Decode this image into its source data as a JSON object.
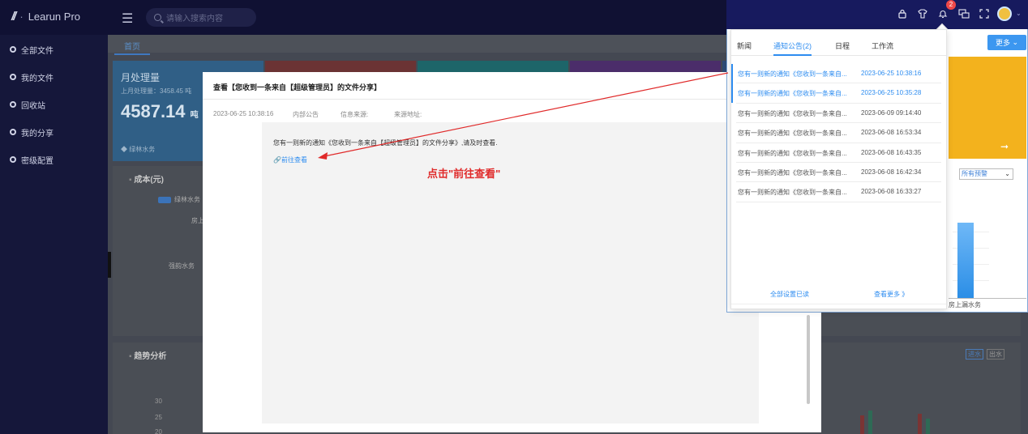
{
  "app": {
    "logo_text": "Learun Pro",
    "search_placeholder": "请输入搜索内容"
  },
  "sidebar": {
    "items": [
      {
        "label": "全部文件",
        "icon": "folder-icon"
      },
      {
        "label": "我的文件",
        "icon": "file-icon"
      },
      {
        "label": "回收站",
        "icon": "trash-icon"
      },
      {
        "label": "我的分享",
        "icon": "share-icon"
      },
      {
        "label": "密级配置",
        "icon": "settings-icon"
      }
    ]
  },
  "tabs": {
    "home": "首页"
  },
  "dashboard": {
    "card_title": "月处理量",
    "card_sub": "上月处理量：3458.45 吨",
    "card_value": "4587.14",
    "card_unit": "吨",
    "card_footer": "◆ 绿林水务",
    "panel1_title": "成本(元)",
    "legend": "绿林水务",
    "label_a": "房上",
    "label_b": "强韵水务",
    "panel2_title": "趋势分析",
    "yticks": [
      "30",
      "25",
      "20"
    ],
    "btn_in": "进水",
    "btn_out": "出水",
    "right_select": "所有预警",
    "right_cat": "房上漏水务",
    "more": "更多"
  },
  "modal": {
    "title": "查看【您收到一条来自【超级管理员】的文件分享】",
    "datetime": "2023-06-25 10:38:16",
    "category": "内部公告",
    "source_label": "信息来源:",
    "url_label": "来源地址:",
    "body": "您有一则新的通知《您收到一条来自【超级管理员】的文件分享》,请及时查看.",
    "link": "前往查看"
  },
  "annotation": {
    "hint": "点击\"前往查看\"",
    "color": "#e02a2a"
  },
  "header": {
    "notification_count": "2"
  },
  "dropdown": {
    "tabs": [
      "新闻",
      "通知公告(2)",
      "日程",
      "工作流"
    ],
    "active_tab": 1,
    "rows": [
      {
        "msg": "您有一则新的通知《您收到一条来自...",
        "time": "2023-06-25 10:38:16",
        "unread": true
      },
      {
        "msg": "您有一则新的通知《您收到一条来自...",
        "time": "2023-06-25 10:35:28",
        "unread": true
      },
      {
        "msg": "您有一则新的通知《您收到一条来自...",
        "time": "2023-06-09 09:14:40",
        "unread": false
      },
      {
        "msg": "您有一则新的通知《您收到一条来自...",
        "time": "2023-06-08 16:53:34",
        "unread": false
      },
      {
        "msg": "您有一则新的通知《您收到一条来自...",
        "time": "2023-06-08 16:43:35",
        "unread": false
      },
      {
        "msg": "您有一则新的通知《您收到一条来自...",
        "time": "2023-06-08 16:42:34",
        "unread": false
      },
      {
        "msg": "您有一则新的通知《您收到一条来自...",
        "time": "2023-06-08 16:33:27",
        "unread": false
      }
    ],
    "mark_all_read": "全部设置已读",
    "see_more": "查看更多 》"
  }
}
